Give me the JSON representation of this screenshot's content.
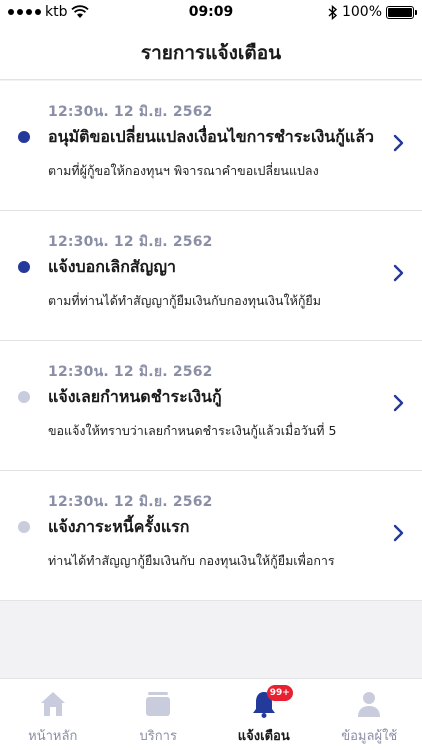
{
  "status_bar": {
    "carrier": "ktb",
    "time": "09:09",
    "battery": "100%"
  },
  "header": {
    "title": "รายการแจ้งเตือน"
  },
  "notifications": [
    {
      "time": "12:30น. 12 มิ.ย. 2562",
      "title": "อนุมัติขอเปลี่ยนแปลงเงื่อนไขการชำระเงินกู้แล้ว",
      "description": "ตามที่ผู้กู้ขอให้กองทุนฯ พิจารณาคำขอเปลี่ยนแปลง",
      "unread": true
    },
    {
      "time": "12:30น. 12 มิ.ย. 2562",
      "title": "แจ้งบอกเลิกสัญญา",
      "description": "ตามที่ท่านได้ทำสัญญากู้ยืมเงินกับกองทุนเงินให้กู้ยืม",
      "unread": true
    },
    {
      "time": "12:30น. 12 มิ.ย. 2562",
      "title": "แจ้งเลยกำหนดชำระเงินกู้",
      "description": "ขอแจ้งให้ทราบว่าเลยกำหนดชำระเงินกู้แล้วเมื่อวันที่ 5",
      "unread": false
    },
    {
      "time": "12:30น. 12 มิ.ย. 2562",
      "title": "แจ้งภาระหนี้ครั้งแรก",
      "description": "ท่านได้ทำสัญญากู้ยืมเงินกับ กองทุนเงินให้กู้ยืมเพื่อการ",
      "unread": false
    }
  ],
  "tab_bar": {
    "items": [
      {
        "label": "หน้าหลัก",
        "icon": "home-icon",
        "active": false
      },
      {
        "label": "บริการ",
        "icon": "services-icon",
        "active": false
      },
      {
        "label": "แจ้งเตือน",
        "icon": "bell-icon",
        "active": true,
        "badge": "99+"
      },
      {
        "label": "ข้อมูลผู้ใช้",
        "icon": "user-icon",
        "active": false
      }
    ]
  },
  "colors": {
    "accent": "#243a9a",
    "unread_dot": "#243a9a",
    "read_dot": "#c9ccdc",
    "badge": "#e8202f",
    "muted_text": "#8a8fa6"
  }
}
